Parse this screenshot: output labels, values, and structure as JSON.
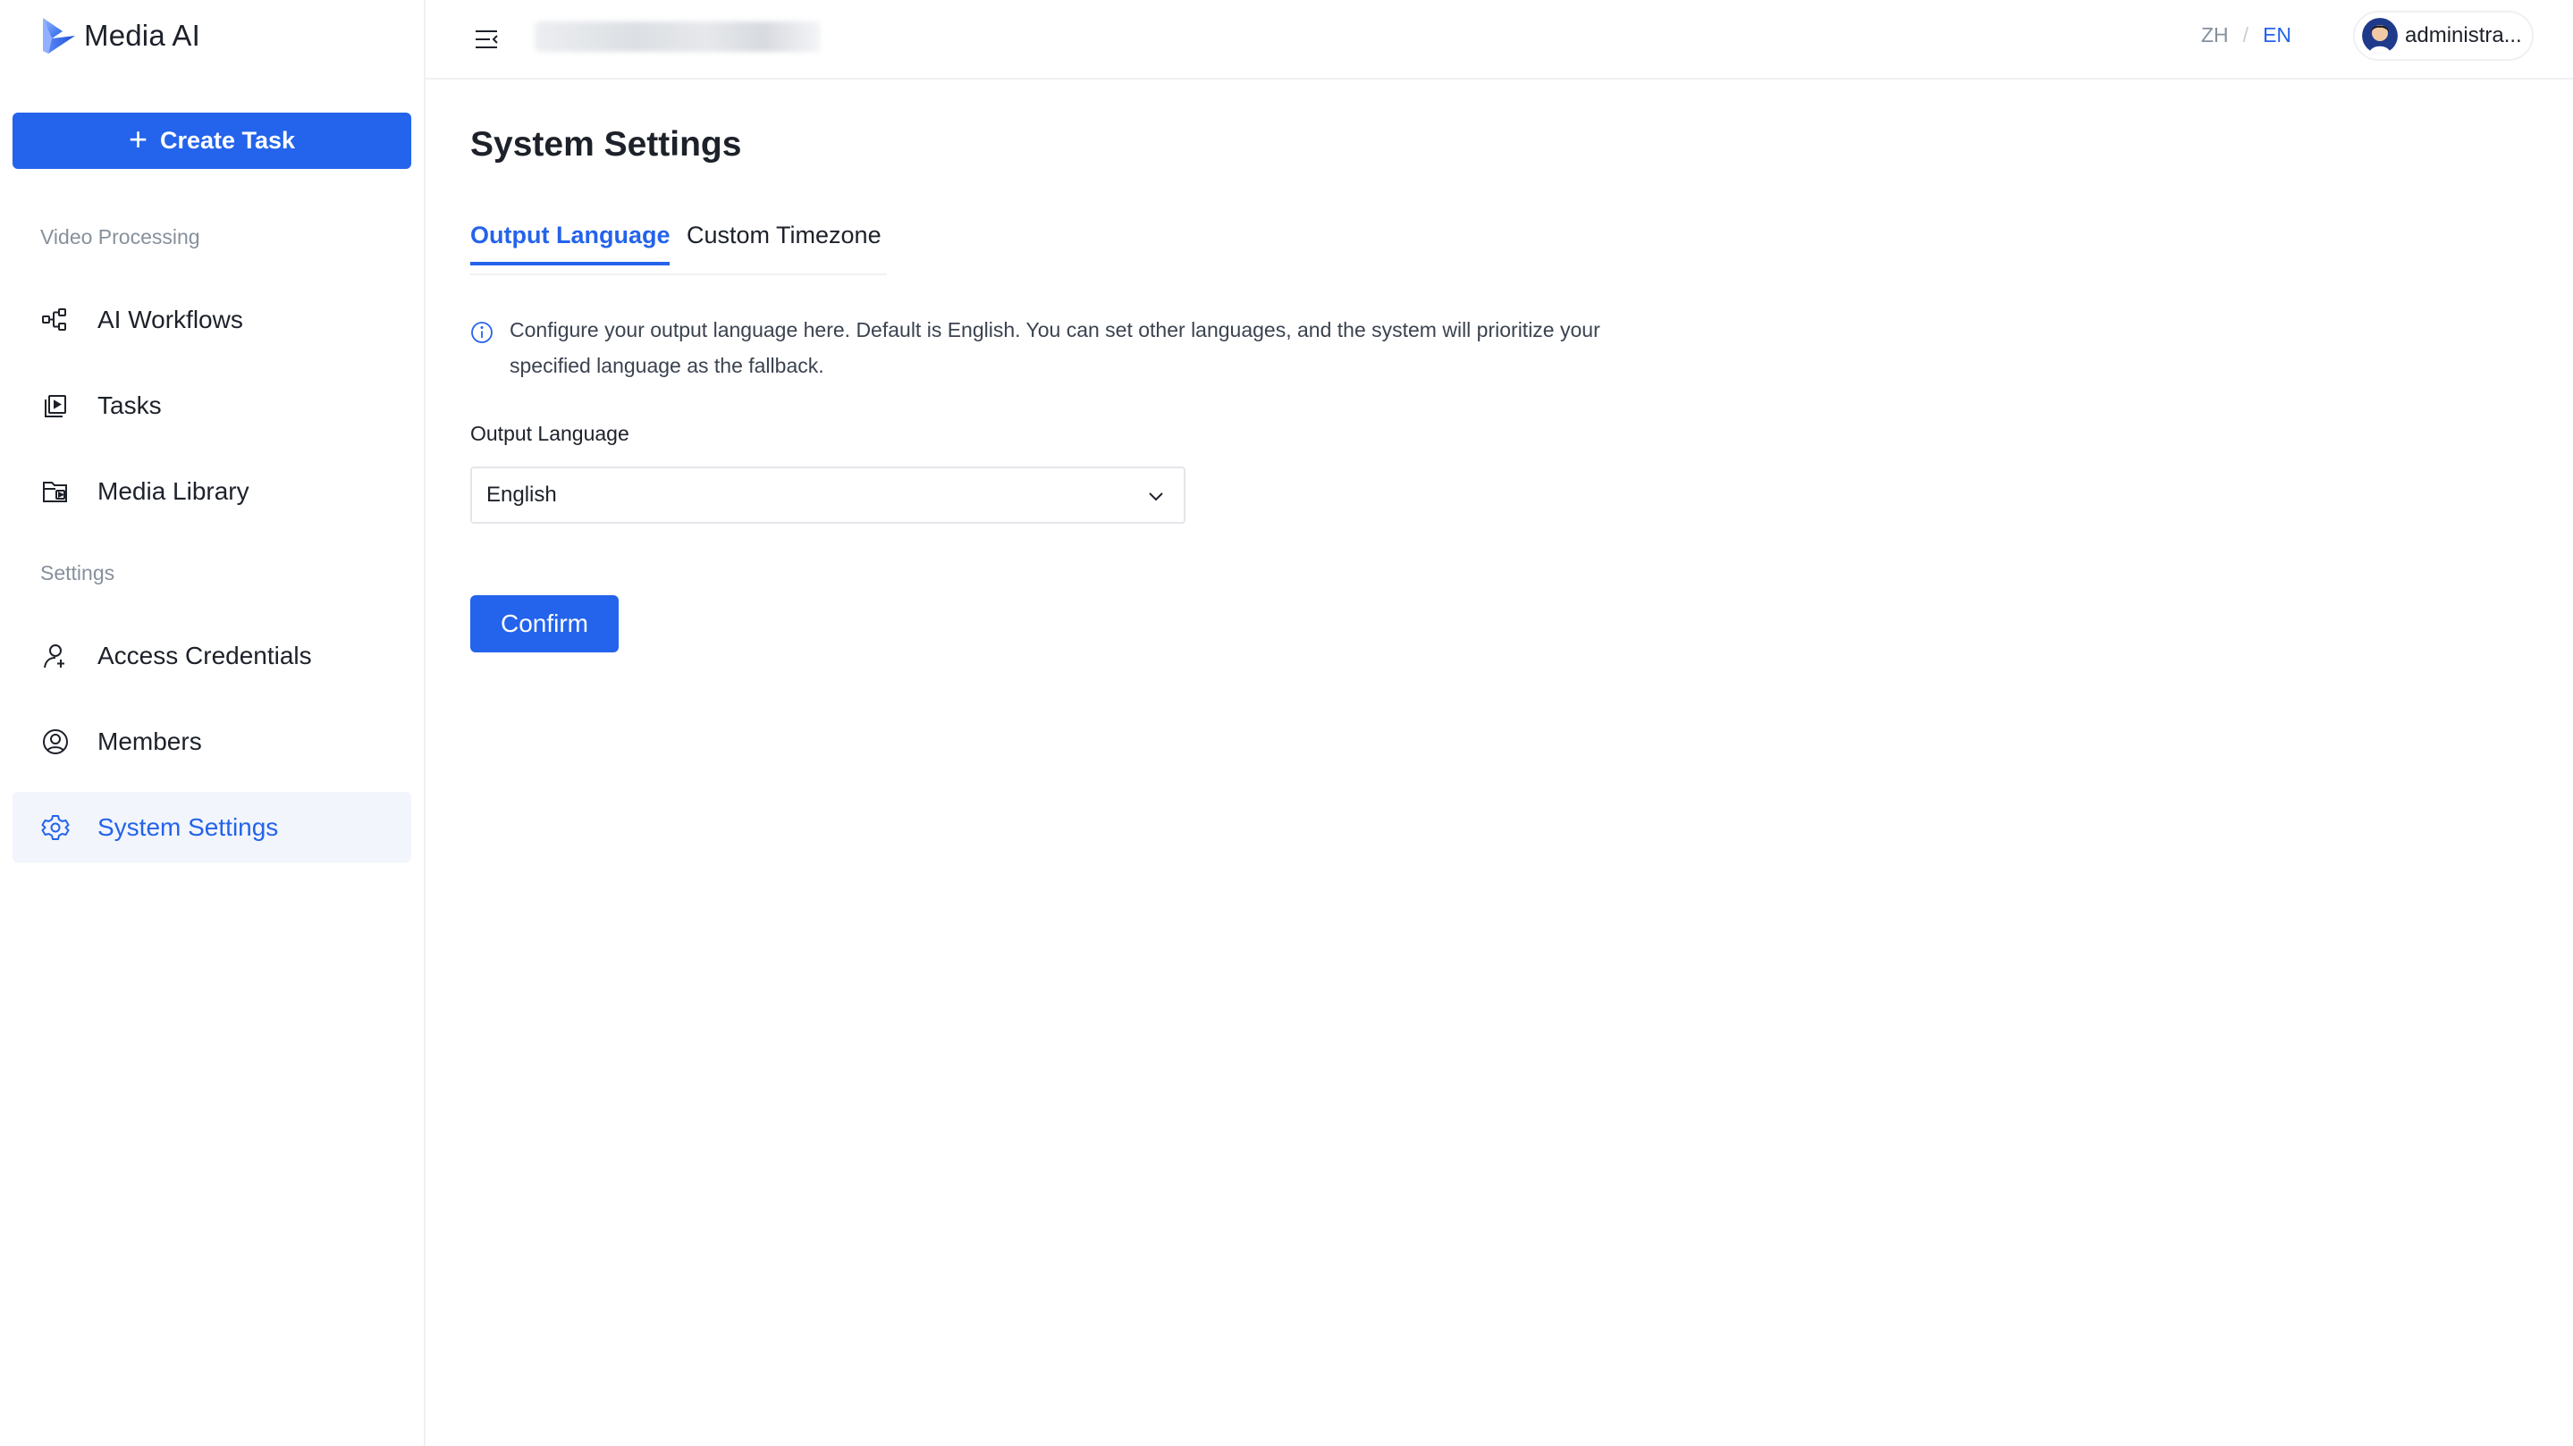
{
  "app": {
    "name": "Media AI",
    "accent_color": "#2463eb"
  },
  "sidebar": {
    "create_button_label": "Create Task",
    "sections": [
      {
        "title": "Video Processing",
        "items": [
          {
            "label": "AI Workflows",
            "icon": "workflow-icon"
          },
          {
            "label": "Tasks",
            "icon": "tasks-icon"
          },
          {
            "label": "Media Library",
            "icon": "folder-media-icon"
          }
        ]
      },
      {
        "title": "Settings",
        "items": [
          {
            "label": "Access Credentials",
            "icon": "key-user-icon"
          },
          {
            "label": "Members",
            "icon": "user-circle-icon"
          },
          {
            "label": "System Settings",
            "icon": "gear-icon",
            "active": true
          }
        ]
      }
    ]
  },
  "header": {
    "lang_options": [
      "ZH",
      "EN"
    ],
    "lang_separator": "/",
    "active_lang": "EN",
    "user_name": "administra..."
  },
  "main": {
    "title": "System Settings",
    "tabs": [
      {
        "label": "Output Language",
        "active": true
      },
      {
        "label": "Custom Timezone",
        "active": false
      }
    ],
    "info_text": "Configure your output language here. Default is English. You can set other languages, and the system will prioritize your specified language as the fallback.",
    "field_label": "Output Language",
    "select_value": "English",
    "confirm_label": "Confirm"
  }
}
